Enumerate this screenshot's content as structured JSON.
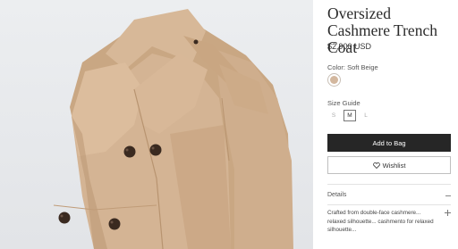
{
  "product": {
    "title": "Oversized Cashmere Trench Coat",
    "price": "$2,900 USD",
    "image_alt": "Oversized camel cashmere trench coat",
    "image_colors": {
      "coat": "#d2b293",
      "coat_shadow": "#b8936f",
      "button": "#3a2a20",
      "background": "#e8eaed"
    }
  },
  "color": {
    "label": "Color: Soft Beige",
    "swatch": "#d3b79e"
  },
  "size_guide": {
    "label": "Size Guide",
    "options": [
      "S",
      "M",
      "L"
    ],
    "selected": "M"
  },
  "actions": {
    "add_to_bag": "Add to Bag",
    "wishlist": "Wishlist",
    "primary_color": "#262626"
  },
  "details": {
    "label": "Details",
    "description": "Crafted from double-face cashmere... relaxed silhouette... cashmento for relaxed silhouette..."
  }
}
